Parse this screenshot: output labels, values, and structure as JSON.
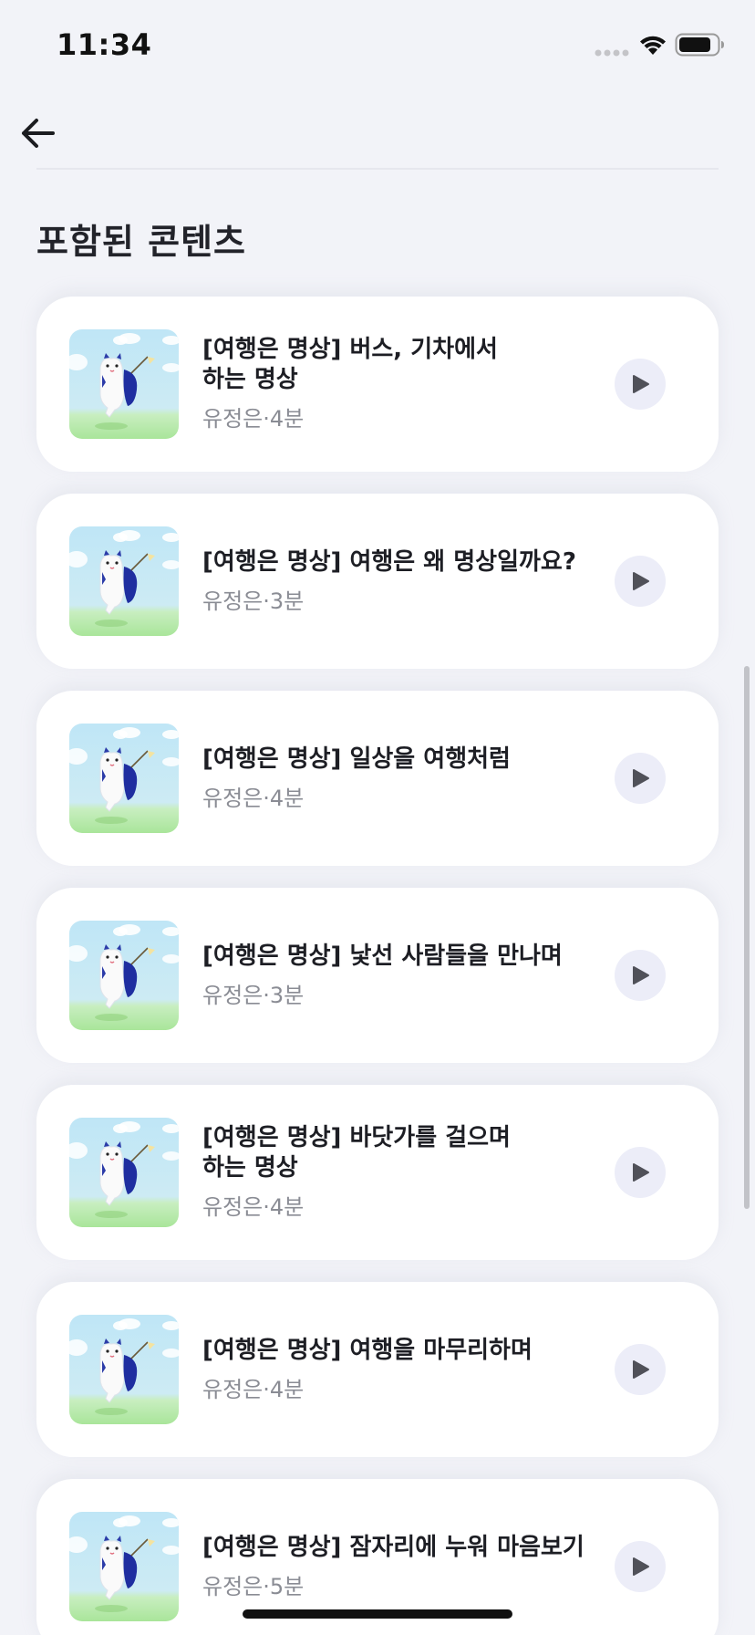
{
  "status_bar": {
    "time": "11:34"
  },
  "header": {
    "back_icon": "arrow-left-icon",
    "section_title": "포함된 콘텐츠"
  },
  "items": [
    {
      "title": "[여행은 명상] 버스, 기차에서\n하는 명상",
      "author": "유정은",
      "duration": "4분"
    },
    {
      "title": "[여행은 명상] 여행은 왜 명상일까요?",
      "author": "유정은",
      "duration": "3분"
    },
    {
      "title": "[여행은 명상] 일상을 여행처럼",
      "author": "유정은",
      "duration": "4분"
    },
    {
      "title": "[여행은 명상] 낯선 사람들을 만나며",
      "author": "유정은",
      "duration": "3분"
    },
    {
      "title": "[여행은 명상] 바닷가를 걸으며\n하는 명상",
      "author": "유정은",
      "duration": "4분"
    },
    {
      "title": "[여행은 명상] 여행을 마무리하며",
      "author": "유정은",
      "duration": "4분"
    },
    {
      "title": "[여행은 명상] 잠자리에 누워 마음보기",
      "author": "유정은",
      "duration": "5분"
    }
  ],
  "colors": {
    "background": "#f2f3f8",
    "card": "#ffffff",
    "play_bg": "#ecedf8",
    "play_icon": "#505159",
    "meta_text": "#8a8c94"
  },
  "icons": {
    "play": "play-icon",
    "thumbnail": "cat-traveler-thumbnail"
  }
}
